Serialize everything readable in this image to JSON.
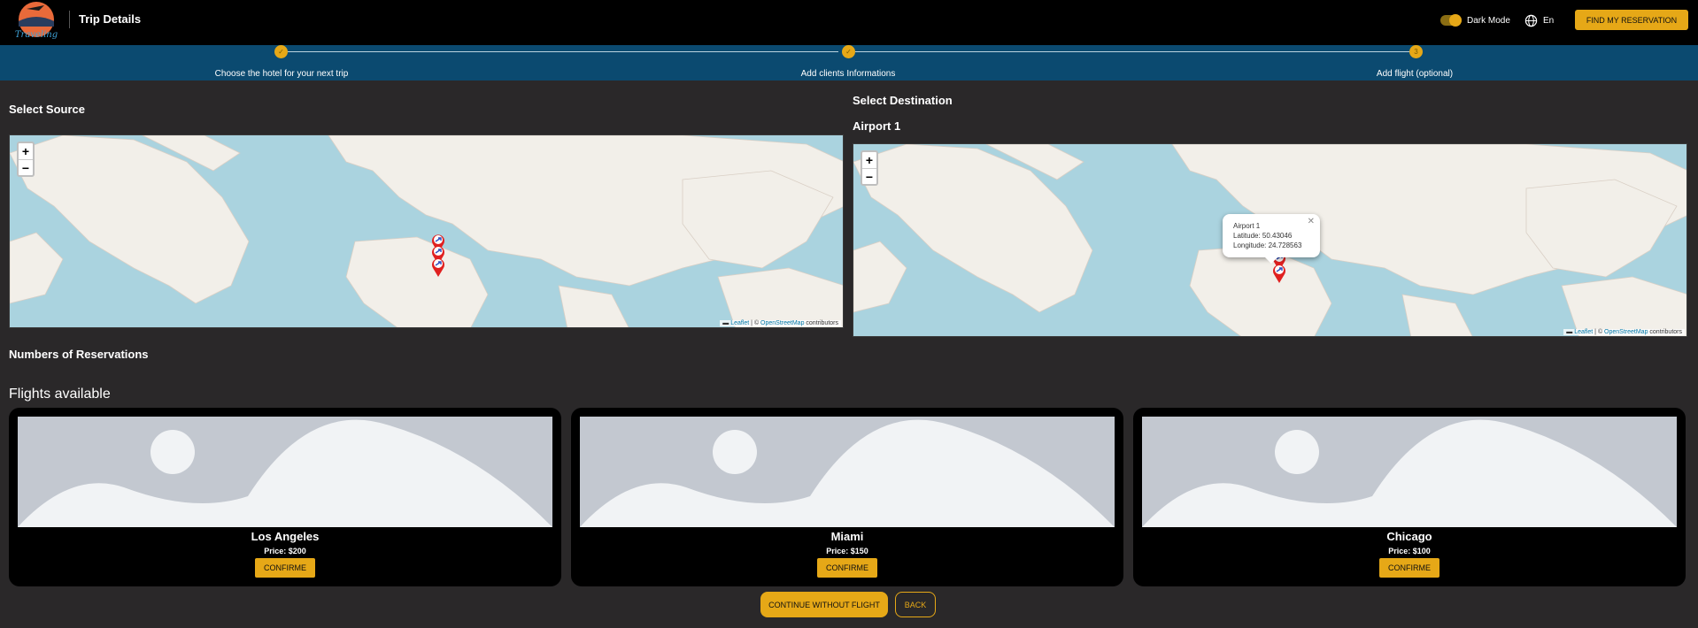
{
  "header": {
    "title": "Trip Details",
    "logo_text": "Traveling",
    "dark_mode_label": "Dark Mode",
    "dark_mode_on": true,
    "language": "En",
    "find_button": "FIND MY RESERVATION"
  },
  "stepper": {
    "steps": [
      {
        "label": "Choose the hotel for your next trip",
        "status": "done",
        "marker": "✓"
      },
      {
        "label": "Add clients Informations",
        "status": "done",
        "marker": "✓"
      },
      {
        "label": "Add flight (optional)",
        "status": "active",
        "marker": "3"
      }
    ]
  },
  "source": {
    "title": "Select Source"
  },
  "destination": {
    "title": "Select Destination",
    "airport_label": "Airport 1",
    "popup": {
      "name": "Airport 1",
      "latitude": "Latitude: 50.43046",
      "longitude": "Longitude: 24.728563"
    }
  },
  "map": {
    "zoom_in": "+",
    "zoom_out": "−",
    "attrib_leaflet": "Leaflet",
    "attrib_sep": " | © ",
    "attrib_osm": "OpenStreetMap",
    "attrib_tail": " contributors"
  },
  "reservations_label": "Numbers of Reservations",
  "flights": {
    "title": "Flights available",
    "confirm_label": "CONFIRME",
    "items": [
      {
        "city": "Los Angeles",
        "price": "Price: $200"
      },
      {
        "city": "Miami",
        "price": "Price: $150"
      },
      {
        "city": "Chicago",
        "price": "Price: $100"
      }
    ]
  },
  "actions": {
    "continue": "CONTINUE WITHOUT FLIGHT",
    "back": "BACK"
  },
  "colors": {
    "accent": "#e6a817",
    "stepper_bg": "#0b4a70",
    "page_bg": "#2a2829",
    "ocean": "#aad3df",
    "land": "#f2efe9",
    "marker": "#e02020"
  }
}
